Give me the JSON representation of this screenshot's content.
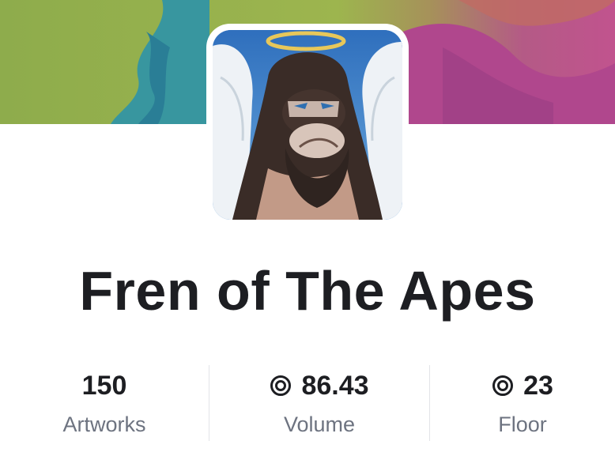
{
  "collection": {
    "name": "Fren of The Apes"
  },
  "stats": [
    {
      "value": "150",
      "label": "Artworks",
      "icon": null
    },
    {
      "value": "86.43",
      "label": "Volume",
      "icon": "currency-ring-icon"
    },
    {
      "value": "23",
      "label": "Floor",
      "icon": "currency-ring-icon"
    }
  ],
  "colors": {
    "text_primary": "#1d1e22",
    "text_secondary": "#6d7380",
    "divider": "#e2e4e8",
    "banner_green": "#8fae4c",
    "banner_magenta": "#b64a8e"
  }
}
